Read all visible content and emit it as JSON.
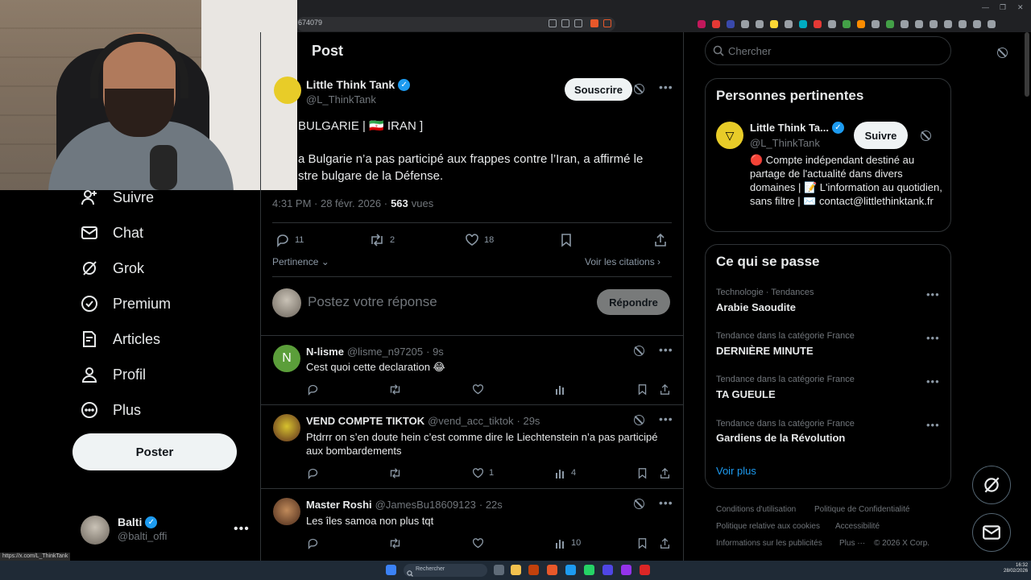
{
  "browser": {
    "url_fragment": "674079",
    "status_url": "https://x.com/L_ThinkTank"
  },
  "nav": {
    "items": [
      {
        "label": "Suivre",
        "icon": "follow-icon"
      },
      {
        "label": "Chat",
        "icon": "mail-icon"
      },
      {
        "label": "Grok",
        "icon": "grok-icon"
      },
      {
        "label": "Premium",
        "icon": "premium-icon"
      },
      {
        "label": "Articles",
        "icon": "articles-icon"
      },
      {
        "label": "Profil",
        "icon": "profile-icon"
      },
      {
        "label": "Plus",
        "icon": "more-circle-icon"
      }
    ],
    "post_button": "Poster",
    "account": {
      "name": "Balti",
      "handle": "@balti_offi",
      "more": "•••"
    }
  },
  "post": {
    "header": "Post",
    "author_name": "Little Think Tank",
    "author_handle": "@L_ThinkTank",
    "subscribe": "Souscrire",
    "text_line1": "BULGARIE | 🇮🇷 IRAN ]",
    "text_line2": "a Bulgarie n’a pas participé aux frappes contre l’Iran, a affirmé le",
    "text_line3": "stre bulgare de la Défense.",
    "time": "4:31 PM · 28 févr. 2026 ·",
    "views_count": "563",
    "views_label": "vues",
    "replies": "11",
    "reposts": "2",
    "likes": "18",
    "filter": "Pertinence",
    "quotes_link": "Voir les citations",
    "reply_placeholder": "Postez votre réponse",
    "reply_button": "Répondre"
  },
  "comments": [
    {
      "name": "N-lisme",
      "handle": "@lisme_n97205",
      "time": "· 9s",
      "text": "Cest quoi cette declaration 😂",
      "avatar_letter": "N",
      "likes": "",
      "views": ""
    },
    {
      "name": "VEND COMPTE TIKTOK",
      "handle": "@vend_acc_tiktok",
      "time": "· 29s",
      "text": "Ptdrrr on s’en doute hein c’est comme dire le Liechtenstein n’a pas participé aux bombardements",
      "avatar_letter": "",
      "likes": "1",
      "views": "4"
    },
    {
      "name": "Master Roshi",
      "handle": "@JamesBu18609123",
      "time": "· 22s",
      "text": "Les îles samoa non plus tqt",
      "avatar_letter": "",
      "likes": "",
      "views": "10"
    }
  ],
  "right": {
    "search_placeholder": "Chercher",
    "people_title": "Personnes pertinentes",
    "person": {
      "name": "Little Think Ta...",
      "handle": "@L_ThinkTank",
      "follow": "Suivre",
      "bio": "🔴 Compte indépendant destiné au partage de l'actualité dans divers domaines | 📝 L'information au quotidien, sans filtre | ✉️ contact@littlethinktank.fr"
    },
    "trends_title": "Ce qui se passe",
    "trends": [
      {
        "category": "Technologie · Tendances",
        "name": "Arabie Saoudite"
      },
      {
        "category": "Tendance dans la catégorie France",
        "name": "DERNIÈRE MINUTE"
      },
      {
        "category": "Tendance dans la catégorie France",
        "name": "TA GUEULE"
      },
      {
        "category": "Tendance dans la catégorie France",
        "name": "Gardiens de la Révolution"
      }
    ],
    "see_more": "Voir plus",
    "footer": {
      "l1": "Conditions d'utilisation",
      "l2": "Politique de Confidentialité",
      "l3": "Politique relative aux cookies",
      "l4": "Accessibilité",
      "l5": "Informations sur les publicités",
      "l6": "Plus ···",
      "l7": "© 2026 X Corp."
    }
  },
  "taskbar": {
    "search": "Rechercher",
    "time": "16:32",
    "date": "28/02/2026"
  },
  "colors": {
    "accent": "#1d9bf0",
    "background": "#000000",
    "border": "#2f3336"
  }
}
